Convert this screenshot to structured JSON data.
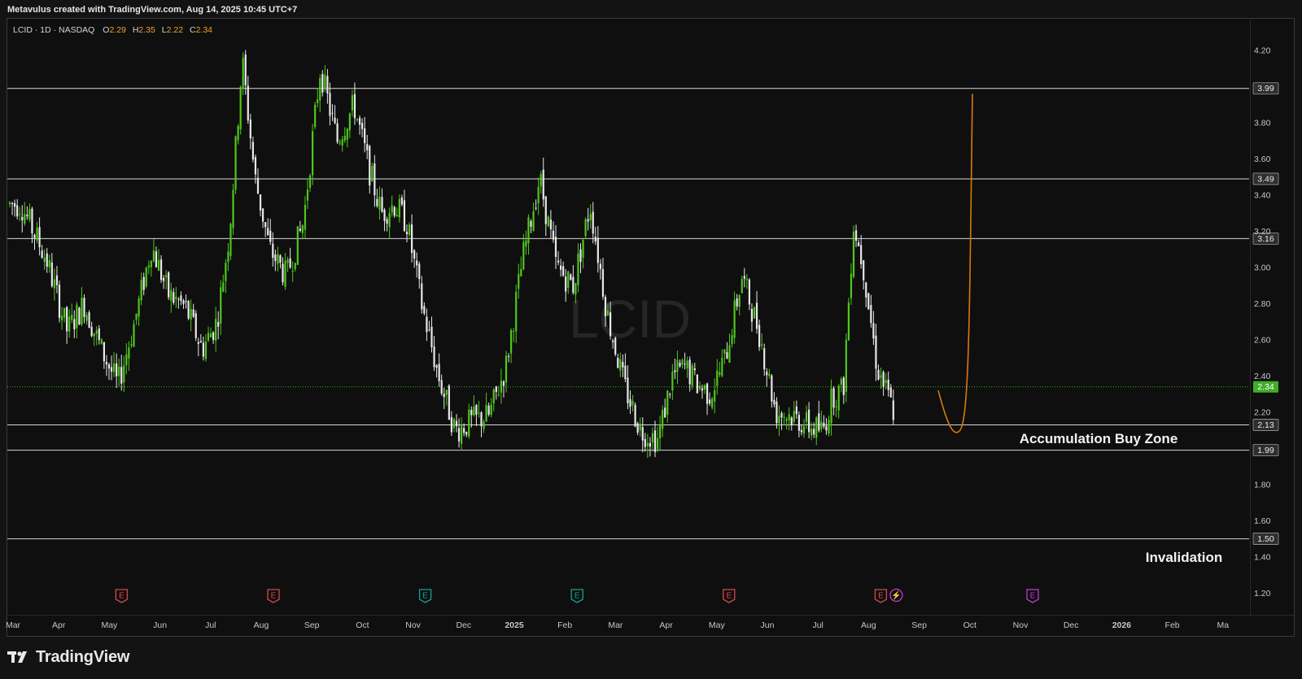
{
  "credit": "Metavulus created with TradingView.com, Aug 14, 2025 10:45 UTC+7",
  "brand": "TradingView",
  "legend": {
    "symbol": "LCID · 1D · NASDAQ",
    "o_label": "O",
    "o_value": "2.29",
    "h_label": "H",
    "h_value": "2.35",
    "l_label": "L",
    "l_value": "2.22",
    "c_label": "C",
    "c_value": "2.34"
  },
  "watermark": "LCID",
  "colors": {
    "up": "#4fc71d",
    "down": "#e8e8e8",
    "orange": "#d9790e",
    "last": "#3fae2a",
    "earnings": "#d84848",
    "earnings_green": "#13a396",
    "earnings_purple": "#c23ad8"
  },
  "chart_data": {
    "type": "candlestick",
    "symbol": "LCID",
    "interval": "1D",
    "exchange": "NASDAQ",
    "ylim": [
      1.08,
      4.38
    ],
    "x_labels": [
      "Mar",
      "Apr",
      "May",
      "Jun",
      "Jul",
      "Aug",
      "Sep",
      "Oct",
      "Nov",
      "Dec",
      "2025",
      "Feb",
      "Mar",
      "Apr",
      "May",
      "Jun",
      "Jul",
      "Aug",
      "Sep",
      "Oct",
      "Nov",
      "Dec",
      "2026",
      "Feb",
      "Ma"
    ],
    "y_ticks": [
      "4.20",
      "3.80",
      "3.60",
      "3.40",
      "3.20",
      "3.00",
      "2.80",
      "2.60",
      "2.40",
      "2.20",
      "1.80",
      "1.60",
      "1.40",
      "1.20"
    ],
    "levels": [
      {
        "value": 3.99,
        "label": "3.99"
      },
      {
        "value": 3.49,
        "label": "3.49"
      },
      {
        "value": 3.16,
        "label": "3.16"
      },
      {
        "value": 2.13,
        "label": "2.13"
      },
      {
        "value": 1.99,
        "label": "1.99"
      },
      {
        "value": 1.5,
        "label": "1.50"
      }
    ],
    "last_price": {
      "value": 2.34,
      "label": "2.34"
    },
    "annotations": [
      {
        "text": "Accumulation Buy Zone",
        "anchor_value": 2.06
      },
      {
        "text": "Invalidation",
        "anchor_value": 1.41
      }
    ],
    "earnings_markers": [
      {
        "month": "May 2024",
        "label": "E",
        "kind": "earnings"
      },
      {
        "month": "Aug 2024",
        "label": "E",
        "kind": "earnings"
      },
      {
        "month": "Nov 2024",
        "label": "E",
        "kind": "earnings_green"
      },
      {
        "month": "Feb 2025",
        "label": "E",
        "kind": "earnings_green"
      },
      {
        "month": "May 2025",
        "label": "E",
        "kind": "earnings"
      },
      {
        "month": "Aug 2025",
        "label": "E",
        "kind": "earnings"
      },
      {
        "month": "Aug 2025",
        "label": "⚡",
        "kind": "earnings_purple"
      },
      {
        "month": "Nov 2025",
        "label": "E",
        "kind": "earnings_purple"
      }
    ],
    "price_path": [
      [
        "Mar 2024",
        3.35
      ],
      [
        "Mar 2024",
        3.05
      ],
      [
        "Apr 2024",
        2.65
      ],
      [
        "Apr 2024",
        2.8
      ],
      [
        "Apr 2024",
        2.55
      ],
      [
        "May 2024",
        2.35
      ],
      [
        "May 2024",
        2.7
      ],
      [
        "May 2024",
        3.12
      ],
      [
        "Jun 2024",
        2.85
      ],
      [
        "Jun 2024",
        2.78
      ],
      [
        "Jun 2024",
        2.55
      ],
      [
        "Jul 2024",
        2.7
      ],
      [
        "Jul 2024",
        3.2
      ],
      [
        "Jul 2024",
        4.15
      ],
      [
        "Jul 2024",
        3.5
      ],
      [
        "Aug 2024",
        3.1
      ],
      [
        "Aug 2024",
        2.95
      ],
      [
        "Aug 2024",
        3.25
      ],
      [
        "Sep 2024",
        4.1
      ],
      [
        "Sep 2024",
        3.7
      ],
      [
        "Sep 2024",
        3.9
      ],
      [
        "Oct 2024",
        3.55
      ],
      [
        "Oct 2024",
        3.3
      ],
      [
        "Oct 2024",
        3.35
      ],
      [
        "Oct 2024",
        3.25
      ],
      [
        "Nov 2024",
        2.8
      ],
      [
        "Nov 2024",
        2.4
      ],
      [
        "Nov 2024",
        2.1
      ],
      [
        "Dec 2024",
        2.15
      ],
      [
        "Dec 2024",
        2.18
      ],
      [
        "Dec 2024",
        2.45
      ],
      [
        "Jan 2025",
        3.05
      ],
      [
        "Jan 2025",
        3.5
      ],
      [
        "Jan 2025",
        3.0
      ],
      [
        "Feb 2025",
        2.9
      ],
      [
        "Feb 2025",
        3.35
      ],
      [
        "Feb 2025",
        2.75
      ],
      [
        "Mar 2025",
        2.35
      ],
      [
        "Mar 2025",
        2.1
      ],
      [
        "Mar 2025",
        2.05
      ],
      [
        "Apr 2025",
        2.4
      ],
      [
        "Apr 2025",
        2.45
      ],
      [
        "Apr 2025",
        2.35
      ],
      [
        "Apr 2025",
        2.3
      ],
      [
        "May 2025",
        2.5
      ],
      [
        "May 2025",
        2.95
      ],
      [
        "May 2025",
        2.65
      ],
      [
        "Jun 2025",
        2.2
      ],
      [
        "Jun 2025",
        2.18
      ],
      [
        "Jun 2025",
        2.12
      ],
      [
        "Jul 2025",
        2.1
      ],
      [
        "Jul 2025",
        2.3
      ],
      [
        "Jul 2025",
        2.32
      ],
      [
        "Jul 2025",
        3.25
      ],
      [
        "Jul 2025",
        3.0
      ],
      [
        "Aug 2025",
        2.45
      ],
      [
        "Aug 2025",
        2.2
      ],
      [
        "Aug 2025",
        2.34
      ]
    ],
    "projection": {
      "from_value": 2.32,
      "low": 2.09,
      "to_value": 3.96,
      "color": "#d9790e"
    }
  }
}
